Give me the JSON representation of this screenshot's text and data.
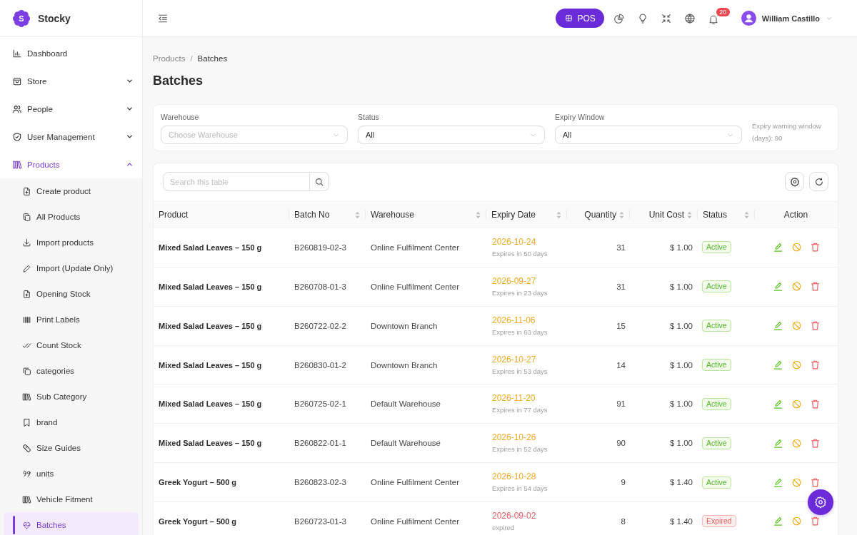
{
  "brand": {
    "logo_letter": "S",
    "name": "Stocky"
  },
  "sidebar": {
    "items": [
      {
        "label": "Dashboard",
        "kind": "link",
        "selected": false
      },
      {
        "label": "Store",
        "kind": "group",
        "selected": false,
        "expanded": false
      },
      {
        "label": "People",
        "kind": "group",
        "selected": false,
        "expanded": false
      },
      {
        "label": "User Management",
        "kind": "group",
        "selected": false,
        "expanded": false
      },
      {
        "label": "Products",
        "kind": "group",
        "selected": true,
        "expanded": true,
        "children": [
          {
            "label": "Create product",
            "selected": false
          },
          {
            "label": "All Products",
            "selected": false
          },
          {
            "label": "Import products",
            "selected": false
          },
          {
            "label": "Import (Update Only)",
            "selected": false
          },
          {
            "label": "Opening Stock",
            "selected": false
          },
          {
            "label": "Print Labels",
            "selected": false
          },
          {
            "label": "Count Stock",
            "selected": false
          },
          {
            "label": "categories",
            "selected": false
          },
          {
            "label": "Sub Category",
            "selected": false
          },
          {
            "label": "brand",
            "selected": false
          },
          {
            "label": "Size Guides",
            "selected": false
          },
          {
            "label": "units",
            "selected": false
          },
          {
            "label": "Vehicle Fitment",
            "selected": false
          },
          {
            "label": "Batches",
            "selected": true
          }
        ]
      }
    ]
  },
  "header": {
    "pos_button": "POS",
    "notification_count": "20",
    "user_name": "William Castillo"
  },
  "breadcrumb": {
    "items": [
      "Products",
      "Batches"
    ],
    "separator": "/"
  },
  "page_title": "Batches",
  "filters": {
    "fields": [
      {
        "label": "Warehouse",
        "placeholder": "Choose Warehouse"
      },
      {
        "label": "Status",
        "value": "All"
      },
      {
        "label": "Expiry Window",
        "value": "All"
      }
    ],
    "note": "Expiry warning window (days): 90"
  },
  "table": {
    "search": {
      "placeholder": "Search this table"
    },
    "columns": [
      {
        "label": "Product",
        "sortable": false
      },
      {
        "label": "Batch No",
        "sortable": true
      },
      {
        "label": "Warehouse",
        "sortable": true
      },
      {
        "label": "Expiry Date",
        "sortable": true
      },
      {
        "label": "Quantity",
        "sortable": true
      },
      {
        "label": "Unit Cost",
        "sortable": true
      },
      {
        "label": "Status",
        "sortable": true
      },
      {
        "label": "Action",
        "sortable": false
      }
    ],
    "rows": [
      {
        "product": "Mixed Salad Leaves – 150 g",
        "batch_no": "B260819-02-3",
        "warehouse": "Online Fulfilment Center",
        "expiry_date": "2026-10-24",
        "expiry_note": "Expires in 50 days",
        "quantity": "31",
        "unit_cost": "$ 1.00",
        "status": "Active",
        "kind": "active"
      },
      {
        "product": "Mixed Salad Leaves – 150 g",
        "batch_no": "B260708-01-3",
        "warehouse": "Online Fulfilment Center",
        "expiry_date": "2026-09-27",
        "expiry_note": "Expires in 23 days",
        "quantity": "31",
        "unit_cost": "$ 1.00",
        "status": "Active",
        "kind": "active"
      },
      {
        "product": "Mixed Salad Leaves – 150 g",
        "batch_no": "B260722-02-2",
        "warehouse": "Downtown Branch",
        "expiry_date": "2026-11-06",
        "expiry_note": "Expires in 63 days",
        "quantity": "15",
        "unit_cost": "$ 1.00",
        "status": "Active",
        "kind": "active"
      },
      {
        "product": "Mixed Salad Leaves – 150 g",
        "batch_no": "B260830-01-2",
        "warehouse": "Downtown Branch",
        "expiry_date": "2026-10-27",
        "expiry_note": "Expires in 53 days",
        "quantity": "14",
        "unit_cost": "$ 1.00",
        "status": "Active",
        "kind": "active"
      },
      {
        "product": "Mixed Salad Leaves – 150 g",
        "batch_no": "B260725-02-1",
        "warehouse": "Default Warehouse",
        "expiry_date": "2026-11-20",
        "expiry_note": "Expires in 77 days",
        "quantity": "91",
        "unit_cost": "$ 1.00",
        "status": "Active",
        "kind": "active"
      },
      {
        "product": "Mixed Salad Leaves – 150 g",
        "batch_no": "B260822-01-1",
        "warehouse": "Default Warehouse",
        "expiry_date": "2026-10-26",
        "expiry_note": "Expires in 52 days",
        "quantity": "90",
        "unit_cost": "$ 1.00",
        "status": "Active",
        "kind": "active"
      },
      {
        "product": "Greek Yogurt – 500 g",
        "batch_no": "B260823-02-3",
        "warehouse": "Online Fulfilment Center",
        "expiry_date": "2026-10-28",
        "expiry_note": "Expires in 54 days",
        "quantity": "9",
        "unit_cost": "$ 1.40",
        "status": "Active",
        "kind": "active"
      },
      {
        "product": "Greek Yogurt – 500 g",
        "batch_no": "B260723-01-3",
        "warehouse": "Online Fulfilment Center",
        "expiry_date": "2026-09-02",
        "expiry_note": "expired",
        "quantity": "8",
        "unit_cost": "$ 1.40",
        "status": "Expired",
        "kind": "expired"
      }
    ]
  }
}
